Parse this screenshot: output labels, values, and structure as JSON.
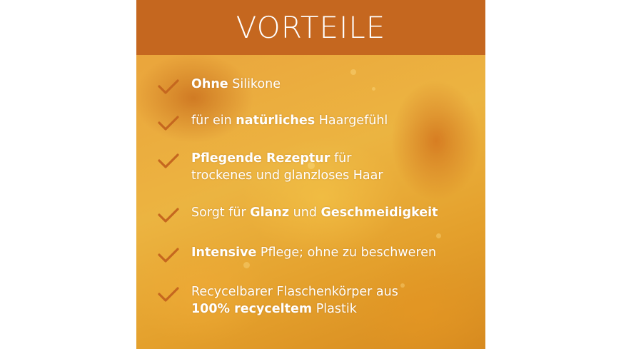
{
  "header": {
    "title": "VORTEILE"
  },
  "accent_color": "#c5671f",
  "check_color": "#c5671f",
  "items": [
    {
      "icon": "checkmark-icon",
      "parts": [
        {
          "bold": "Ohne"
        },
        {
          "normal": " Silikone"
        }
      ]
    },
    {
      "icon": "checkmark-icon",
      "parts": [
        {
          "normal": "für ein "
        },
        {
          "bold": "natürliches"
        },
        {
          "normal": " Haargefühl"
        }
      ]
    },
    {
      "icon": "checkmark-icon",
      "parts": [
        {
          "bold": "Pflegende Rezeptur"
        },
        {
          "normal": " für"
        },
        {
          "break": true
        },
        {
          "normal": "trockenes und glanzloses Haar"
        }
      ]
    },
    {
      "icon": "checkmark-icon",
      "parts": [
        {
          "normal": "Sorgt für "
        },
        {
          "bold": "Glanz"
        },
        {
          "normal": " und "
        },
        {
          "bold": "Geschmeidigkeit"
        }
      ]
    },
    {
      "icon": "checkmark-icon",
      "parts": [
        {
          "bold": "Intensive"
        },
        {
          "normal": " Pflege; ohne zu beschweren"
        }
      ]
    },
    {
      "icon": "checkmark-icon",
      "parts": [
        {
          "normal": "Recycelbarer Flaschenkörper aus"
        },
        {
          "break": true
        },
        {
          "bold": "100% recyceltem"
        },
        {
          "normal": " Plastik"
        }
      ]
    }
  ]
}
